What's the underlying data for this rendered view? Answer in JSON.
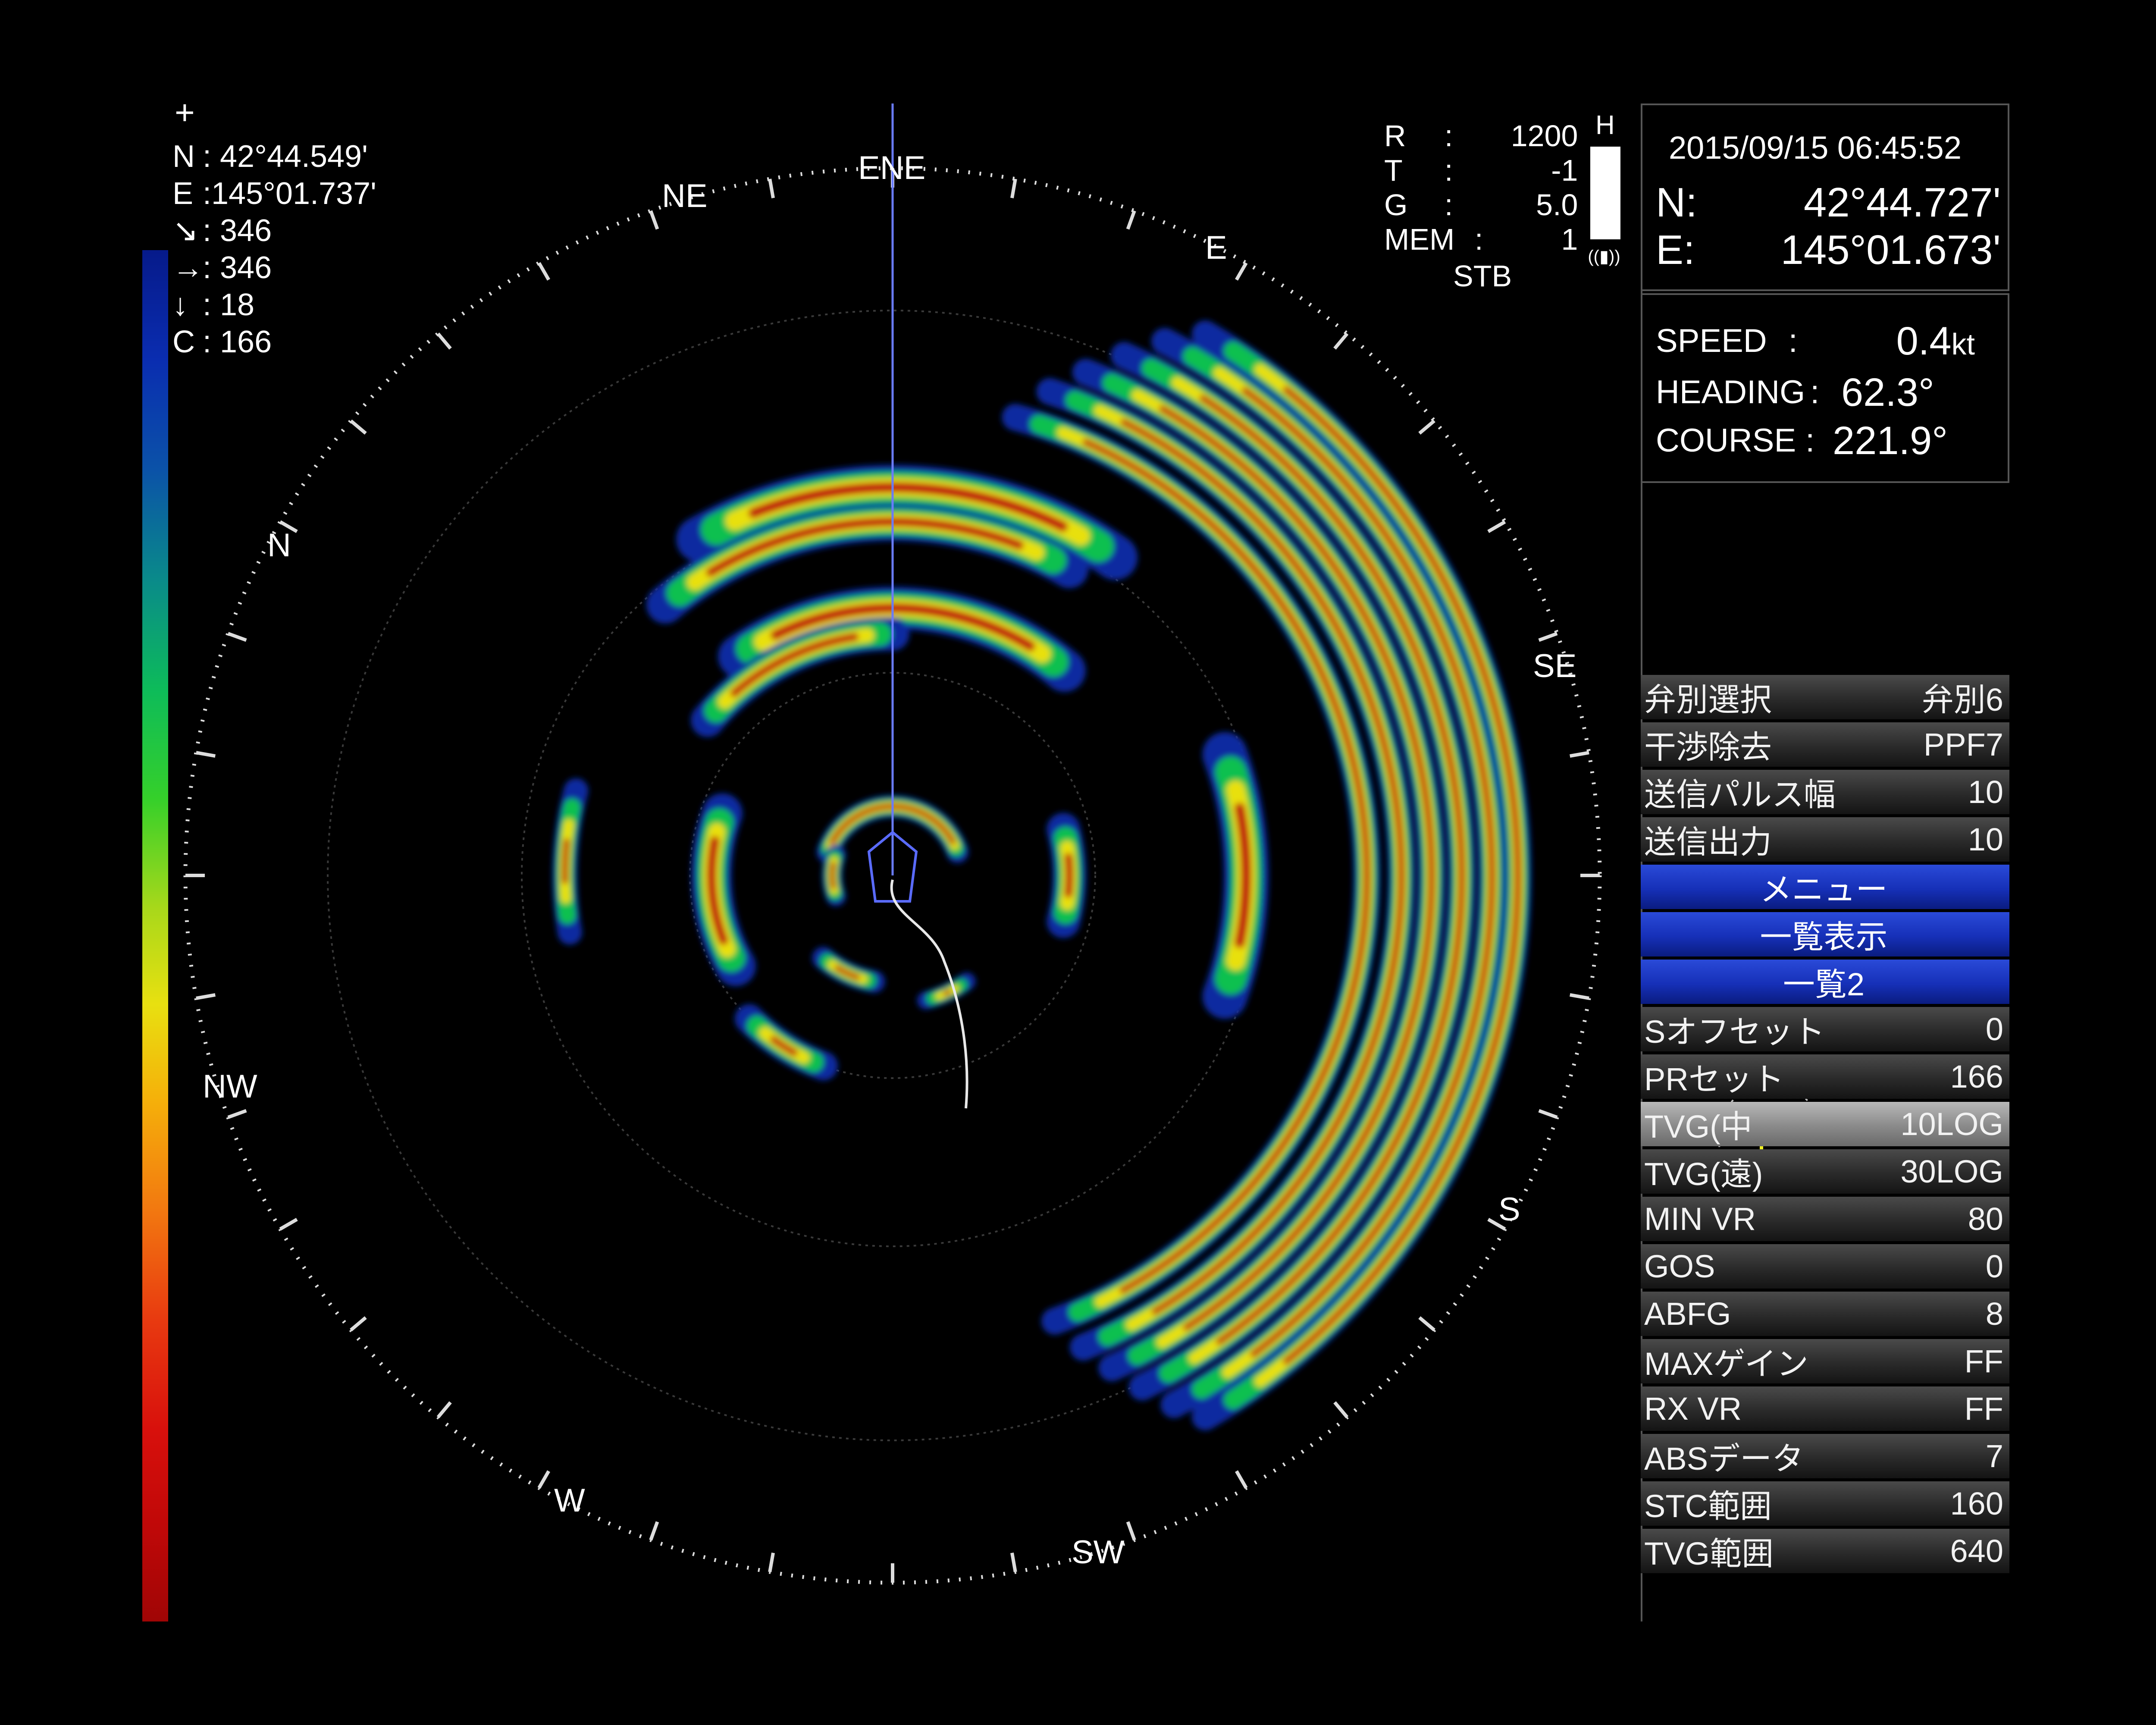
{
  "cursor_info": {
    "plus": "+",
    "rows": [
      {
        "key": "N",
        "sep": ":",
        "value": "42°44.549'"
      },
      {
        "key": "E",
        "sep": ":",
        "value": "145°01.737'"
      },
      {
        "key": "↘",
        "sep": ":",
        "value": "346"
      },
      {
        "key": "→",
        "sep": ":",
        "value": "346"
      },
      {
        "key": "↓",
        "sep": ":",
        "value": "18"
      },
      {
        "key": "C",
        "sep": ":",
        "value": "166"
      }
    ]
  },
  "sonar_params": {
    "rows": [
      {
        "key": "R",
        "sep": ":",
        "value": "1200"
      },
      {
        "key": "T",
        "sep": ":",
        "value": "-1"
      },
      {
        "key": "G",
        "sep": ":",
        "value": "5.0"
      },
      {
        "key": "MEM",
        "sep": ":",
        "value": "1"
      }
    ],
    "mode": "STB",
    "h_label": "H"
  },
  "status": {
    "datetime": "2015/09/15 06:45:52",
    "lat_label": "N:",
    "lat": "42°44.727'",
    "lon_label": "E:",
    "lon": "145°01.673'"
  },
  "navigation": {
    "speed_label": "SPEED",
    "speed_sep": ":",
    "speed": "0.4",
    "speed_unit": "kt",
    "heading_label": "HEADING",
    "heading_sep": ":",
    "heading": "62.3°",
    "course_label": "COURSE",
    "course_sep": ":",
    "course": "221.9°"
  },
  "compass": {
    "labels": [
      "ENE",
      "NE",
      "N",
      "NW",
      "W",
      "SW",
      "S",
      "SE",
      "E"
    ]
  },
  "menu": [
    {
      "label": "弁別選択",
      "value": "弁別6",
      "style": "gray"
    },
    {
      "label": "干渉除去",
      "value": "PPF7",
      "style": "gray"
    },
    {
      "label": "送信パルス幅",
      "value": "10",
      "style": "gray"
    },
    {
      "label": "送信出力",
      "value": "10",
      "style": "gray"
    },
    {
      "label": "メニュー",
      "value": "",
      "style": "blue"
    },
    {
      "label": "一覧表示",
      "value": "",
      "style": "blue"
    },
    {
      "label": "一覧2",
      "value": "",
      "style": "blue"
    },
    {
      "label": "Sオフセット",
      "value": "0",
      "style": "gray"
    },
    {
      "label": "PRセット",
      "value": "166",
      "style": "gray"
    },
    {
      "label": "TVG(中",
      "value": "10LOG",
      "style": "selected"
    },
    {
      "label": "TVG(遠)",
      "value": "30LOG",
      "style": "gray"
    },
    {
      "label": "MIN VR",
      "value": "80",
      "style": "gray"
    },
    {
      "label": "GOS",
      "value": "0",
      "style": "gray"
    },
    {
      "label": "ABFG",
      "value": "8",
      "style": "gray"
    },
    {
      "label": "MAXゲイン",
      "value": "FF",
      "style": "gray"
    },
    {
      "label": "RX VR",
      "value": "FF",
      "style": "gray"
    },
    {
      "label": "ABSデータ",
      "value": "7",
      "style": "gray"
    },
    {
      "label": "STC範囲",
      "value": "160",
      "style": "gray"
    },
    {
      "label": "TVG範囲",
      "value": "640",
      "style": "gray"
    }
  ],
  "colors": {
    "echo_strong": "#c01010",
    "echo_mid": "#e8e010",
    "echo_low": "#10c050",
    "echo_weak": "#0a2aa0",
    "menu_blue": "#1630b8"
  }
}
